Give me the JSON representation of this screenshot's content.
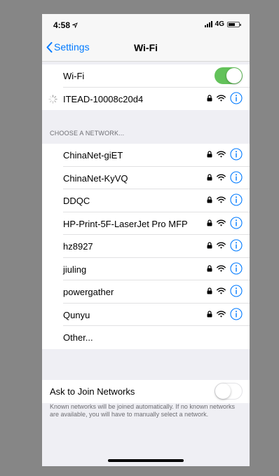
{
  "status": {
    "time": "4:58",
    "network": "4G"
  },
  "nav": {
    "back_label": "Settings",
    "title": "Wi-Fi"
  },
  "wifi": {
    "label": "Wi-Fi",
    "enabled": true
  },
  "connected": {
    "name": "ITEAD-10008c20d4"
  },
  "section_header": "CHOOSE A NETWORK...",
  "networks": [
    {
      "name": "ChinaNet-giET",
      "secured": true
    },
    {
      "name": "ChinaNet-KyVQ",
      "secured": true
    },
    {
      "name": "DDQC",
      "secured": true
    },
    {
      "name": "HP-Print-5F-LaserJet Pro MFP",
      "secured": true
    },
    {
      "name": "hz8927",
      "secured": true
    },
    {
      "name": "jiuling",
      "secured": true
    },
    {
      "name": "powergather",
      "secured": true
    },
    {
      "name": "Qunyu",
      "secured": true
    }
  ],
  "other_label": "Other...",
  "ask_join": {
    "label": "Ask to Join Networks",
    "enabled": false
  },
  "footer": "Known networks will be joined automatically. If no known networks are available, you will have to manually select a network.",
  "colors": {
    "accent": "#007aff",
    "toggle_on": "#63c25a"
  }
}
